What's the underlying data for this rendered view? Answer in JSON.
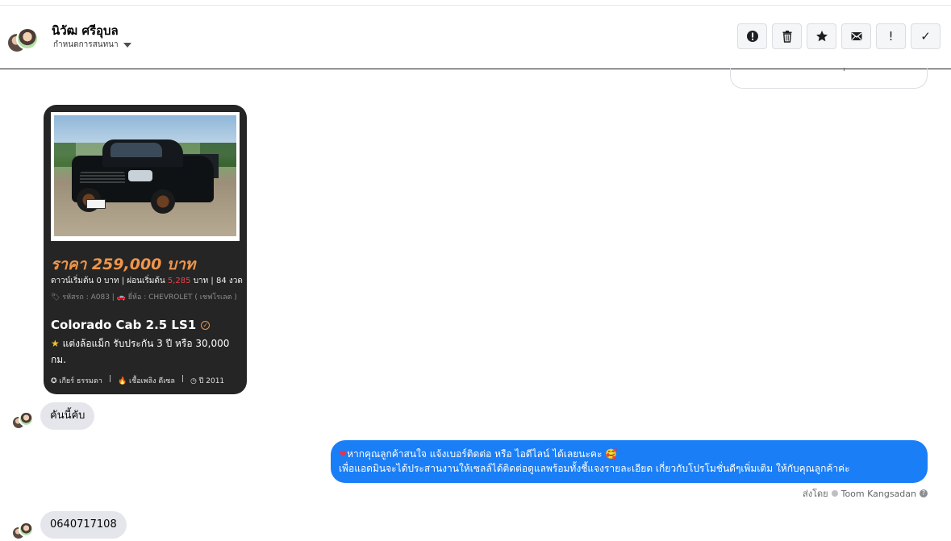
{
  "header": {
    "contact_name": "นิวัฒ ศรีอุบล",
    "assign_label": "กำหนดการสนทนา",
    "toolbar": [
      {
        "name": "spam-button",
        "icon": "alert-circle-icon",
        "label": ""
      },
      {
        "name": "delete-button",
        "icon": "trash-icon",
        "label": ""
      },
      {
        "name": "star-button",
        "icon": "star-icon",
        "label": ""
      },
      {
        "name": "mark-unread-button",
        "icon": "envelope-icon",
        "label": ""
      },
      {
        "name": "priority-button",
        "icon": "exclamation-icon",
        "label": "!"
      },
      {
        "name": "done-button",
        "icon": "check-icon",
        "label": "✓"
      }
    ]
  },
  "card": {
    "price": "ราคา 259,000 บาท",
    "terms_prefix": "ดาวน์เริ่มต้น 0 บาท | ผ่อนเริ่มต้น ",
    "terms_highlight": "5,285",
    "terms_suffix": " บาท | 84 งวด",
    "meta": "🏷 รหัสรถ : A083 | 🚗 ยี่ห้อ : CHEVROLET ( เชฟโรเลต )",
    "model": "Colorado Cab 2.5 LS1",
    "feature": "แต่งล้อแม็ก รับประกัน 3 ปี หรือ 30,000 กม.",
    "spec_gear": "✪ เกียร์ ธรรมดา",
    "spec_fuel": "🔥 เชื้อเพลิง ดีเซล",
    "spec_year": "◷ ปี 2011",
    "spec_sep": "|"
  },
  "messages": {
    "incoming_1": "คันนี้คับ",
    "outgoing_line1": "หากคุณลูกค้าสนใจ แจ้งเบอร์ติดต่อ หรือ ไอดีไลน์ ได้เลยนะคะ 🥰",
    "outgoing_line2": "เพื่อแอดมินจะได้ประสานงานให้เซลล์ได้ติดต่อดูแลพร้อมทั้งชี้แจงรายละเอียด เกี่ยวกับโปรโมชั่นดีๆเพิ่มเติม ให้กับคุณลูกค้าค่ะ",
    "sent_by_label": "ส่งโดย",
    "sent_by_name": "Toom Kangsadan",
    "incoming_2": "0640717108"
  },
  "colors": {
    "outgoing_bubble": "#1a7ef7",
    "incoming_bubble": "#e4e6eb",
    "price_orange": "#f0954a",
    "card_bg": "#252525"
  }
}
